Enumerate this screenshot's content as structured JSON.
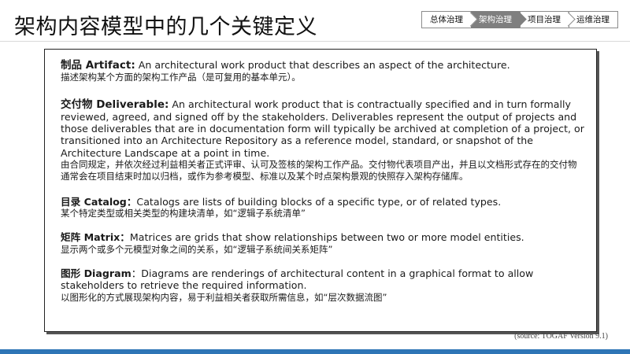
{
  "page": {
    "title": "架构内容模型中的几个关键定义",
    "source": "(source: TOGAF Version 9.1)"
  },
  "nav": {
    "items": [
      {
        "label": "总体治理"
      },
      {
        "label": "架构治理"
      },
      {
        "label": "项目治理"
      },
      {
        "label": "运维治理"
      }
    ],
    "active_index": 1
  },
  "definitions": {
    "artifact": {
      "term": "制品 Artifact:",
      "en": "An architectural work product that describes an aspect of the architecture.",
      "zh": "描述架构某个方面的架构工作产品（是可复用的基本单元）。"
    },
    "deliverable": {
      "term": "交付物 Deliverable:",
      "en": "An architectural work product that is contractually specified and in turn formally reviewed, agreed, and signed off by the stakeholders. Deliverables represent the output of projects and those deliverables that are in documentation form will typically be archived at completion of a project, or transitioned into an Architecture Repository as a reference model, standard, or snapshot of the Architecture Landscape at a point in time.",
      "zh": "由合同规定，并依次经过利益相关者正式评审、认可及签核的架构工作产品。交付物代表项目产出，并且以文档形式存在的交付物通常会在项目结束时加以归档，或作为参考模型、标准以及某个时点架构景观的快照存入架构存储库。"
    },
    "catalog": {
      "term": "目录 Catalog：",
      "en": "Catalogs are lists of building blocks of a specific type, or of related types.",
      "zh": "某个特定类型或相关类型的构建块清单，如“逻辑子系统清单”"
    },
    "matrix": {
      "term": "矩阵 Matrix：",
      "en": "Matrices are grids that show relationships between two or more model entities.",
      "zh": "显示两个或多个元模型对象之间的关系，如“逻辑子系统间关系矩阵”"
    },
    "diagram": {
      "term": "图形 Diagram",
      "sep": "：",
      "en": "Diagrams are renderings of architectural content in a graphical format to allow stakeholders to retrieve the required information.",
      "zh": "以图形化的方式展现架构内容，易于利益相关者获取所需信息，如“层次数据流图”"
    }
  },
  "colors": {
    "accent_bar": "#2e75b6",
    "nav_active_bg": "#7f7f7f"
  }
}
